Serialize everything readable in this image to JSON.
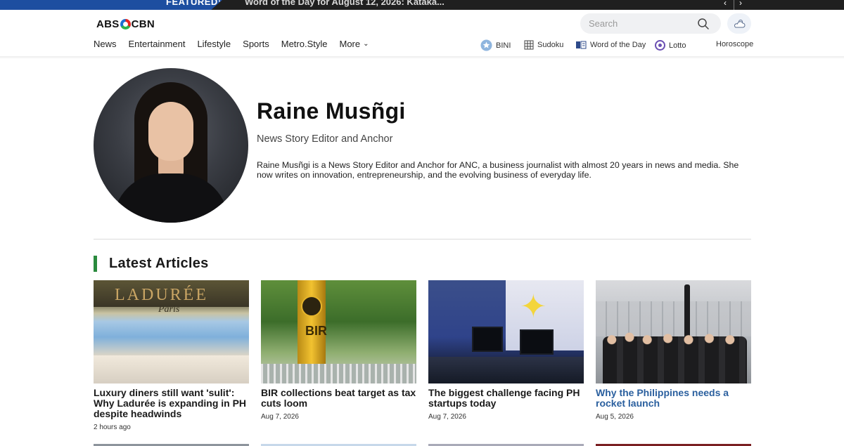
{
  "featured": {
    "label": "FEATURED:",
    "text": "Word of the Day for August 12, 2026: Kataka...",
    "prev_icon": "chevron-left-icon",
    "next_icon": "chevron-right-icon"
  },
  "header": {
    "logo_text": "ABS-CBN",
    "search": {
      "placeholder": "Search",
      "value": ""
    },
    "weather_icon": "cloud-sun-icon"
  },
  "nav": {
    "items": [
      {
        "label": "News"
      },
      {
        "label": "Entertainment"
      },
      {
        "label": "Lifestyle"
      },
      {
        "label": "Sports"
      },
      {
        "label": "Metro.Style"
      },
      {
        "label": "More"
      }
    ],
    "utilities": [
      {
        "label": "BINI",
        "icon": "bini-star-icon"
      },
      {
        "label": "Sudoku",
        "icon": "sudoku-grid-icon"
      },
      {
        "label": "Word of the Day",
        "icon": "book-icon"
      },
      {
        "label": "Lotto",
        "icon": "lotto-ball-icon"
      },
      {
        "label": "Horoscope",
        "icon": "horoscope-icon"
      }
    ]
  },
  "profile": {
    "name": "Raine Musñgi",
    "role": "News Story Editor and Anchor",
    "bio": "Raine Musñgi is a News Story Editor and Anchor for ANC, a business journalist with almost 20 years in news and media. She now writes on innovation, entrepreneurship, and the evolving business of everyday life."
  },
  "latest": {
    "title": "Latest Articles",
    "articles": [
      {
        "headline": "Luxury diners still want 'sulit': Why Ladurée is expanding in PH despite headwinds",
        "date": "2 hours ago",
        "thumb_sign": "LADURÉE",
        "thumb_sub": "Paris"
      },
      {
        "headline": "BIR collections beat target as tax cuts loom",
        "date": "Aug 7, 2026",
        "thumb_sign": "BIR"
      },
      {
        "headline": "The biggest challenge facing PH startups today",
        "date": "Aug 7, 2026"
      },
      {
        "headline": "Why the Philippines needs a rocket launch",
        "date": "Aug 5, 2026"
      }
    ]
  },
  "colors": {
    "featured_blue": "#1d4ea0",
    "accent_green": "#2a8a3d",
    "link_blue": "#2a5f9e"
  }
}
